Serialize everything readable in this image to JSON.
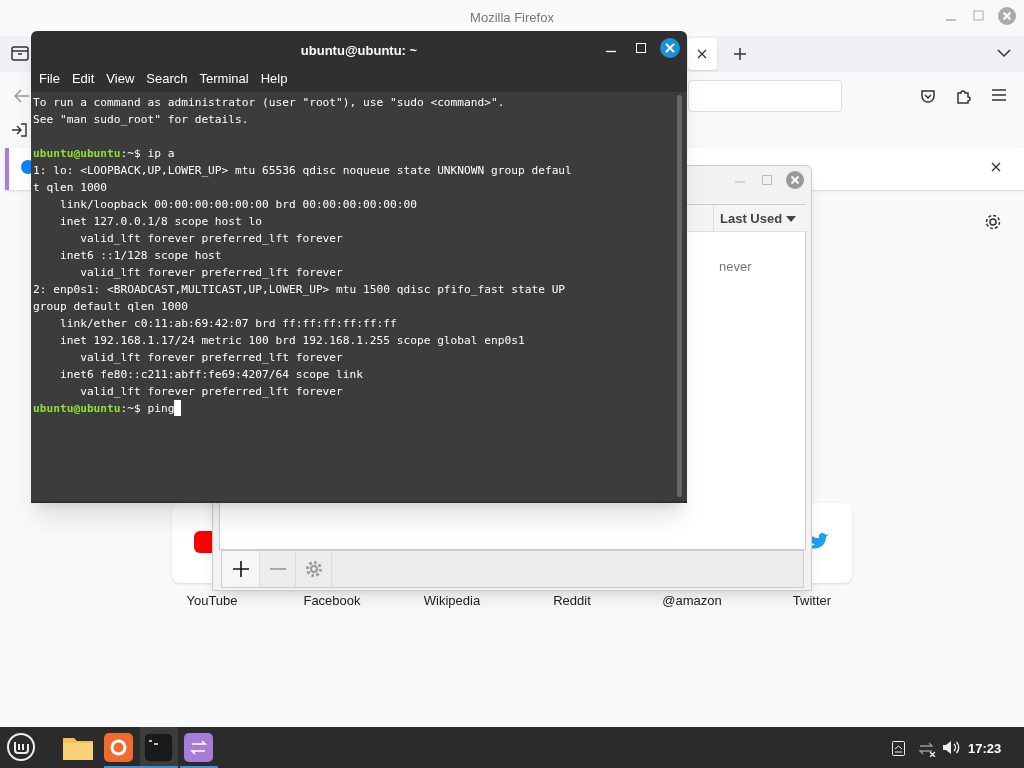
{
  "firefox": {
    "title": "Mozilla Firefox",
    "shortcuts": [
      {
        "label": "YouTube"
      },
      {
        "label": "Facebook"
      },
      {
        "label": "Wikipedia"
      },
      {
        "label": "Reddit"
      },
      {
        "label": "@amazon"
      },
      {
        "label": "Twitter"
      }
    ]
  },
  "connections_dialog": {
    "columns": [
      {
        "label": "Last Used",
        "sorted": true
      }
    ],
    "rows": [
      {
        "last_used": "never"
      }
    ]
  },
  "terminal": {
    "title": "ubuntu@ubuntu: ~",
    "menu": [
      "File",
      "Edit",
      "View",
      "Search",
      "Terminal",
      "Help"
    ],
    "lines": [
      {
        "kind": "text",
        "text": "To run a command as administrator (user \"root\"), use \"sudo <command>\"."
      },
      {
        "kind": "text",
        "text": "See \"man sudo_root\" for details."
      },
      {
        "kind": "blank"
      },
      {
        "kind": "prompt",
        "user": "ubuntu@ubuntu",
        "text": ":~$ ip a"
      },
      {
        "kind": "text",
        "text": "1: lo: <LOOPBACK,UP,LOWER_UP> mtu 65536 qdisc noqueue state UNKNOWN group defaul"
      },
      {
        "kind": "text",
        "text": "t qlen 1000"
      },
      {
        "kind": "text",
        "text": "    link/loopback 00:00:00:00:00:00 brd 00:00:00:00:00:00"
      },
      {
        "kind": "text",
        "text": "    inet 127.0.0.1/8 scope host lo"
      },
      {
        "kind": "text",
        "text": "       valid_lft forever preferred_lft forever"
      },
      {
        "kind": "text",
        "text": "    inet6 ::1/128 scope host"
      },
      {
        "kind": "text",
        "text": "       valid_lft forever preferred_lft forever"
      },
      {
        "kind": "text",
        "text": "2: enp0s1: <BROADCAST,MULTICAST,UP,LOWER_UP> mtu 1500 qdisc pfifo_fast state UP"
      },
      {
        "kind": "text",
        "text": "group default qlen 1000"
      },
      {
        "kind": "text",
        "text": "    link/ether c0:11:ab:69:42:07 brd ff:ff:ff:ff:ff:ff"
      },
      {
        "kind": "text",
        "text": "    inet 192.168.1.17/24 metric 100 brd 192.168.1.255 scope global enp0s1"
      },
      {
        "kind": "text",
        "text": "       valid_lft forever preferred_lft forever"
      },
      {
        "kind": "text",
        "text": "    inet6 fe80::c211:abff:fe69:4207/64 scope link"
      },
      {
        "kind": "text",
        "text": "       valid_lft forever preferred_lft forever"
      },
      {
        "kind": "prompt",
        "user": "ubuntu@ubuntu",
        "text": ":~$ ping",
        "cursor": true
      }
    ]
  },
  "taskbar": {
    "clock": "17:23"
  }
}
